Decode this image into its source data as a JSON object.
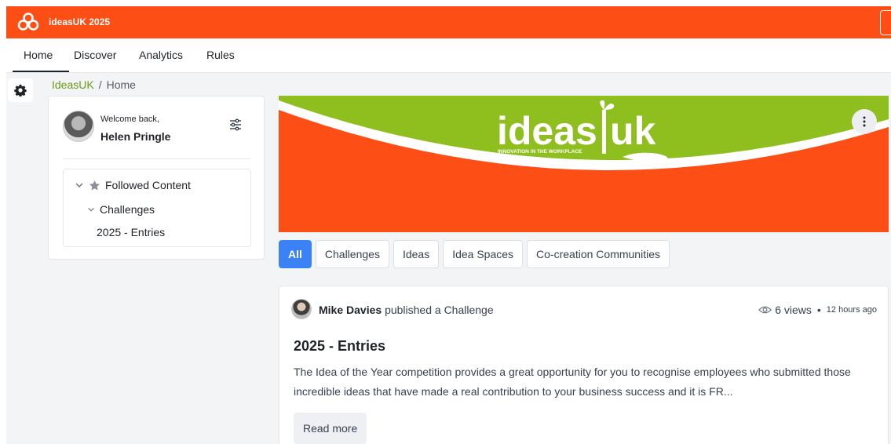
{
  "colors": {
    "brand": "#fd4e15",
    "accent": "#3b82f6",
    "breadcrumb_link": "#6b9b15",
    "banner_green": "#8fbf1f"
  },
  "app": {
    "title": "ideasUK 2025",
    "logo_icon": "ideas-logo-icon"
  },
  "nav": {
    "items": [
      {
        "label": "Home"
      },
      {
        "label": "Discover"
      },
      {
        "label": "Analytics"
      },
      {
        "label": "Rules"
      }
    ],
    "active": "Home"
  },
  "rail": {
    "icon": "gear-icon"
  },
  "breadcrumb": {
    "root": "IdeasUK",
    "separator": "/",
    "current": "Home"
  },
  "welcome": {
    "greeting": "Welcome back,",
    "name": "Helen Pringle",
    "settings_icon": "sliders-icon",
    "tree": {
      "root": "Followed Content",
      "child": "Challenges",
      "leaf": "2025 - Entries"
    }
  },
  "banner": {
    "wordmark": "ideas uk",
    "tagline": "INNOVATION IN THE WORKPLACE",
    "menu_icon": "kebab-icon"
  },
  "filters": [
    {
      "label": "All",
      "active": true
    },
    {
      "label": "Challenges"
    },
    {
      "label": "Ideas"
    },
    {
      "label": "Idea Spaces"
    },
    {
      "label": "Co-creation Communities"
    }
  ],
  "post": {
    "author": "Mike Davies",
    "action": "published a Challenge",
    "views": "6 views",
    "bullet": "•",
    "time_ago": "12 hours ago",
    "title": "2025 - Entries",
    "body": "The Idea of the Year competition provides a great opportunity for you to recognise employees who submitted those incredible ideas that have made a real contribution to your business success and it is FR...",
    "read_more": "Read more"
  }
}
